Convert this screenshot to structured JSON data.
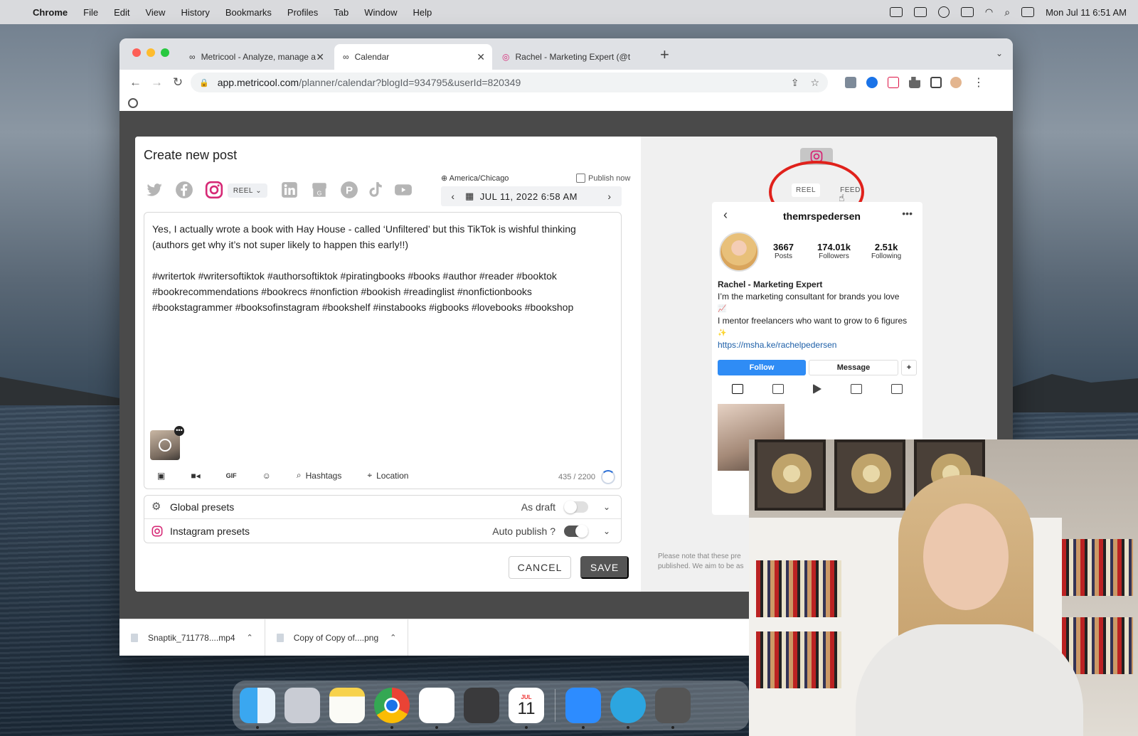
{
  "menubar": {
    "app": "Chrome",
    "items": [
      "File",
      "Edit",
      "View",
      "History",
      "Bookmarks",
      "Profiles",
      "Tab",
      "Window",
      "Help"
    ],
    "clock": "Mon Jul 11  6:51 AM"
  },
  "browser": {
    "tabs": [
      {
        "label": "Metricool - Analyze, manage a",
        "icon": "infinity-icon"
      },
      {
        "label": "Calendar",
        "icon": "infinity-icon"
      },
      {
        "label": "Rachel - Marketing Expert (@t",
        "icon": "instagram-icon"
      }
    ],
    "url_host": "app.metricool.com",
    "url_path": "/planner/calendar?blogId=934795&userId=820349"
  },
  "modal": {
    "title": "Create new post",
    "format_select": "REEL",
    "timezone": "America/Chicago",
    "publish_now": "Publish now",
    "date": "JUL 11, 2022 6:58 AM",
    "text_lines": [
      "Yes, I actually wrote a book with Hay House - called ‘Unfiltered’ but this TikTok is wishful thinking",
      "(authors get why it’s not super likely to happen this early!!)",
      "",
      "#writertok #writersoftiktok #authorsoftiktok #piratingbooks #books #author #reader #booktok",
      "#bookrecommendations #bookrecs #nonfiction #bookish #readinglist  #nonfictionbooks",
      "#bookstagrammer  #booksofinstagram  #bookshelf  #instabooks  #igbooks  #lovebooks  #bookshop"
    ],
    "tools": {
      "gif": "GIF",
      "hashtags": "Hashtags",
      "location": "Location"
    },
    "char_count": "435 / 2200",
    "presets": [
      {
        "label": "Global presets",
        "state": "As draft",
        "toggle_on": false
      },
      {
        "label": "Instagram presets",
        "state": "Auto publish  ?",
        "toggle_on": true
      }
    ],
    "cancel": "CANCEL",
    "save": "SAVE"
  },
  "preview": {
    "tabs": [
      "REEL",
      "FEED"
    ],
    "username": "themrspedersen",
    "stats": [
      {
        "n": "3667",
        "l": "Posts"
      },
      {
        "n": "174.01k",
        "l": "Followers"
      },
      {
        "n": "2.51k",
        "l": "Following"
      }
    ],
    "name": "Rachel - Marketing Expert",
    "bio1": "I’m the marketing consultant for brands you love",
    "bio2": "I mentor freelancers who want to grow to 6 figures",
    "link": "https://msha.ke/rachelpedersen",
    "follow": "Follow",
    "message": "Message",
    "disclaimer": "Please note that these pre published. We aim to be as"
  },
  "downloads": [
    {
      "name": "Snaptik_711778....mp4"
    },
    {
      "name": "Copy of Copy of....png"
    }
  ],
  "dock": {
    "calendar_month": "JUL",
    "calendar_day": "11"
  },
  "colors": {
    "highlight_circle": "#e0211b",
    "follow_blue": "#2f8cf5",
    "toggle_on": "#555555"
  }
}
